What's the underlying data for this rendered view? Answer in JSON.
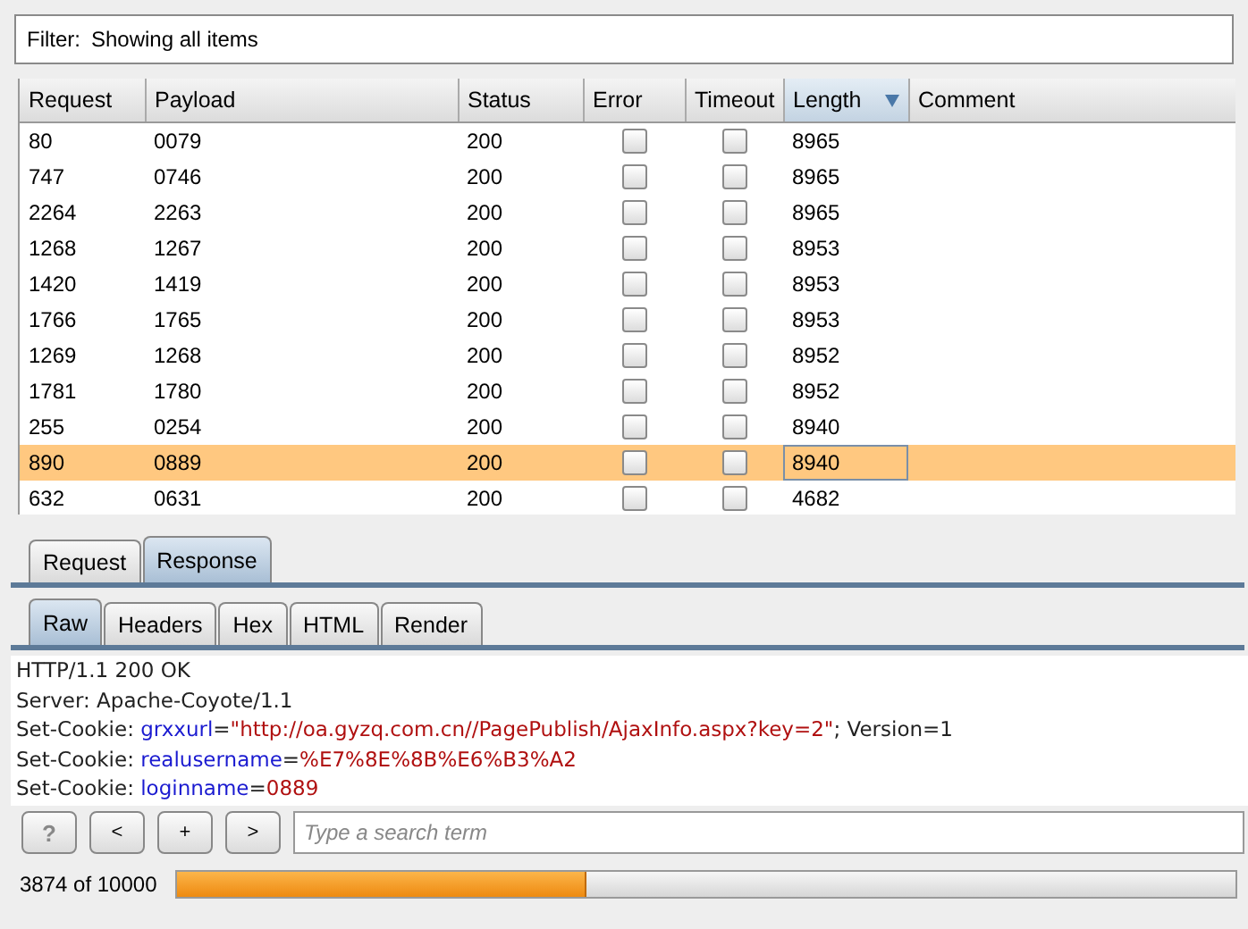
{
  "filter": {
    "label": "Filter:",
    "text": "Showing all items"
  },
  "table": {
    "columns": [
      {
        "label": "Request",
        "sorted": false
      },
      {
        "label": "Payload",
        "sorted": false
      },
      {
        "label": "Status",
        "sorted": false
      },
      {
        "label": "Error",
        "sorted": false
      },
      {
        "label": "Timeout",
        "sorted": false
      },
      {
        "label": "Length",
        "sorted": true
      },
      {
        "label": "Comment",
        "sorted": false
      }
    ],
    "rows": [
      {
        "request": "80",
        "payload": "0079",
        "status": "200",
        "error": false,
        "timeout": false,
        "length": "8965",
        "selected": false
      },
      {
        "request": "747",
        "payload": "0746",
        "status": "200",
        "error": false,
        "timeout": false,
        "length": "8965",
        "selected": false
      },
      {
        "request": "2264",
        "payload": "2263",
        "status": "200",
        "error": false,
        "timeout": false,
        "length": "8965",
        "selected": false
      },
      {
        "request": "1268",
        "payload": "1267",
        "status": "200",
        "error": false,
        "timeout": false,
        "length": "8953",
        "selected": false
      },
      {
        "request": "1420",
        "payload": "1419",
        "status": "200",
        "error": false,
        "timeout": false,
        "length": "8953",
        "selected": false
      },
      {
        "request": "1766",
        "payload": "1765",
        "status": "200",
        "error": false,
        "timeout": false,
        "length": "8953",
        "selected": false
      },
      {
        "request": "1269",
        "payload": "1268",
        "status": "200",
        "error": false,
        "timeout": false,
        "length": "8952",
        "selected": false
      },
      {
        "request": "1781",
        "payload": "1780",
        "status": "200",
        "error": false,
        "timeout": false,
        "length": "8952",
        "selected": false
      },
      {
        "request": "255",
        "payload": "0254",
        "status": "200",
        "error": false,
        "timeout": false,
        "length": "8940",
        "selected": false
      },
      {
        "request": "890",
        "payload": "0889",
        "status": "200",
        "error": false,
        "timeout": false,
        "length": "8940",
        "selected": true
      },
      {
        "request": "632",
        "payload": "0631",
        "status": "200",
        "error": false,
        "timeout": false,
        "length": "4682",
        "selected": false
      }
    ]
  },
  "message_tabs": [
    {
      "label": "Request",
      "selected": false
    },
    {
      "label": "Response",
      "selected": true
    }
  ],
  "view_tabs": [
    {
      "label": "Raw",
      "selected": true
    },
    {
      "label": "Headers",
      "selected": false
    },
    {
      "label": "Hex",
      "selected": false
    },
    {
      "label": "HTML",
      "selected": false
    },
    {
      "label": "Render",
      "selected": false
    }
  ],
  "response_lines": [
    [
      {
        "kind": "plain",
        "text": "HTTP/1.1 200 OK"
      }
    ],
    [
      {
        "kind": "plain",
        "text": "Server: Apache-Coyote/1.1"
      }
    ],
    [
      {
        "kind": "plain",
        "text": "Set-Cookie: "
      },
      {
        "kind": "name",
        "text": "grxxurl"
      },
      {
        "kind": "plain",
        "text": "="
      },
      {
        "kind": "value",
        "text": "\"http://oa.gyzq.com.cn//PagePublish/AjaxInfo.aspx?key=2\""
      },
      {
        "kind": "plain",
        "text": "; Version=1"
      }
    ],
    [
      {
        "kind": "plain",
        "text": "Set-Cookie: "
      },
      {
        "kind": "name",
        "text": "realusername"
      },
      {
        "kind": "plain",
        "text": "="
      },
      {
        "kind": "value",
        "text": "%E7%8E%8B%E6%B3%A2"
      }
    ],
    [
      {
        "kind": "plain",
        "text": "Set-Cookie: "
      },
      {
        "kind": "name",
        "text": "loginname"
      },
      {
        "kind": "plain",
        "text": "="
      },
      {
        "kind": "value",
        "text": "0889"
      }
    ]
  ],
  "search": {
    "buttons": [
      "?",
      "<",
      "+",
      ">"
    ],
    "placeholder": "Type a search term"
  },
  "progress": {
    "text": "3874 of 10000",
    "level": 0.3874
  }
}
